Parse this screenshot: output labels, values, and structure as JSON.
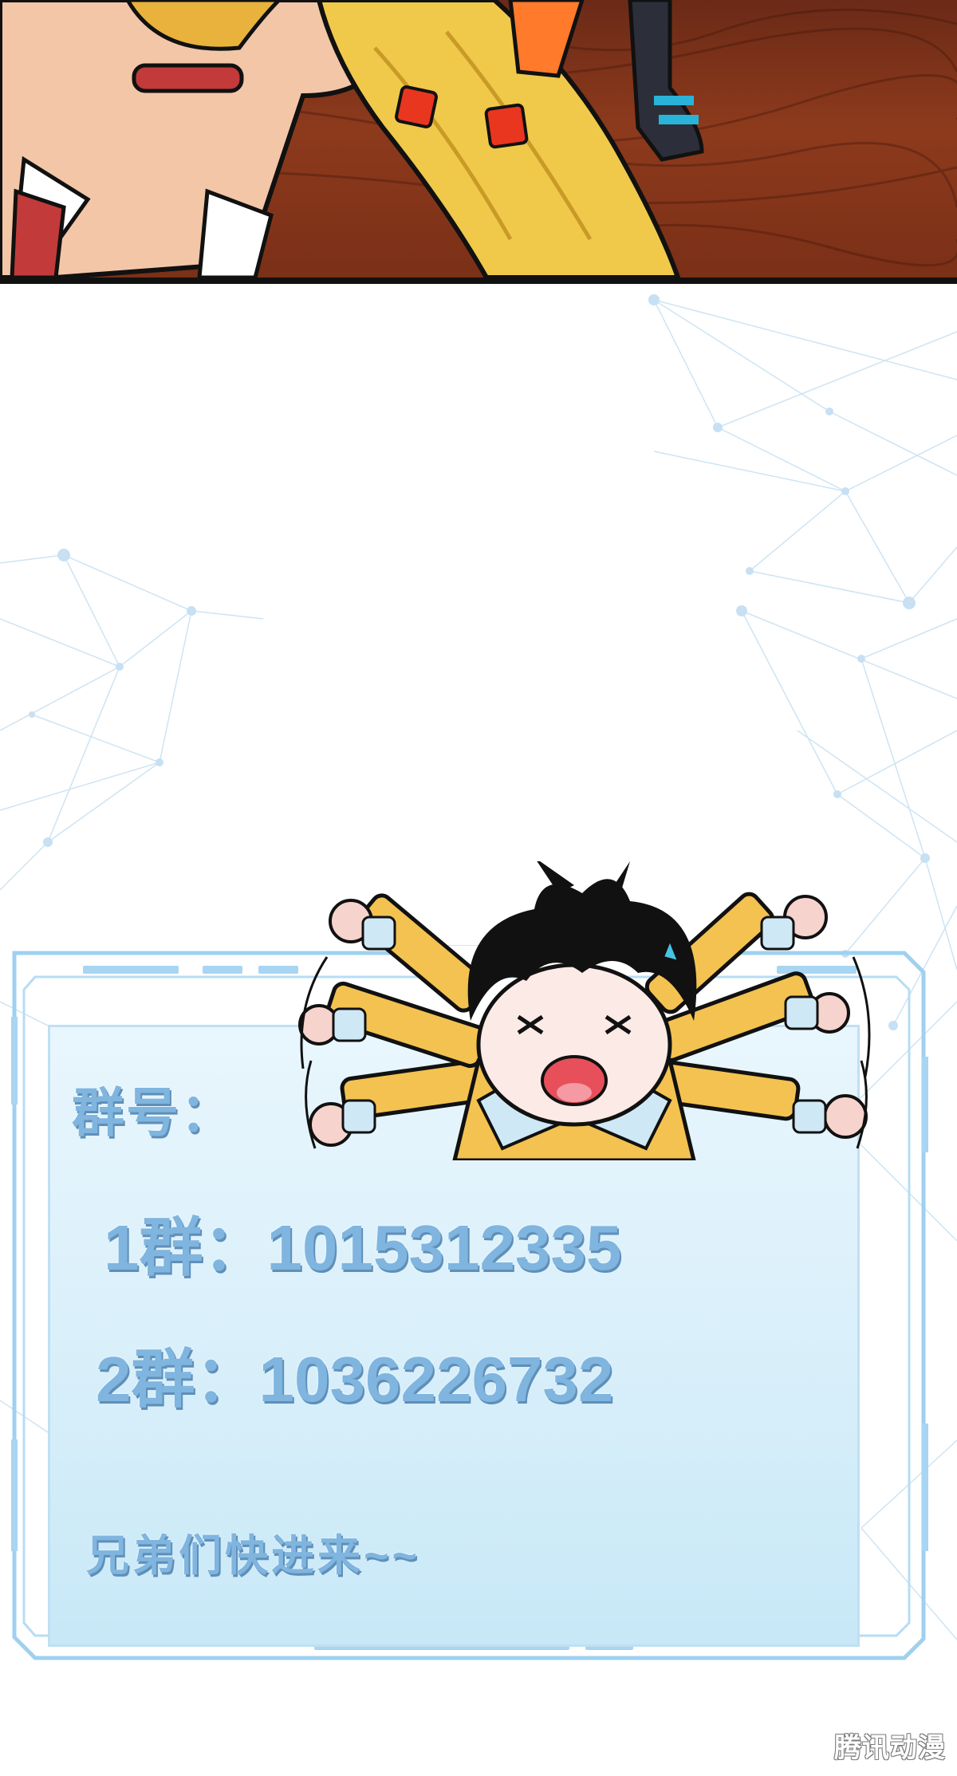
{
  "group_info": {
    "heading": "群号：",
    "group_1": "1群：1015312335",
    "group_2": "2群：1036226732",
    "invite": "兄弟们快进来~~"
  },
  "watermark": "腾讯动漫",
  "colors": {
    "text_blue": "#7fb5df",
    "frame_blue": "#9fd0f0",
    "panel_border": "#111111"
  }
}
